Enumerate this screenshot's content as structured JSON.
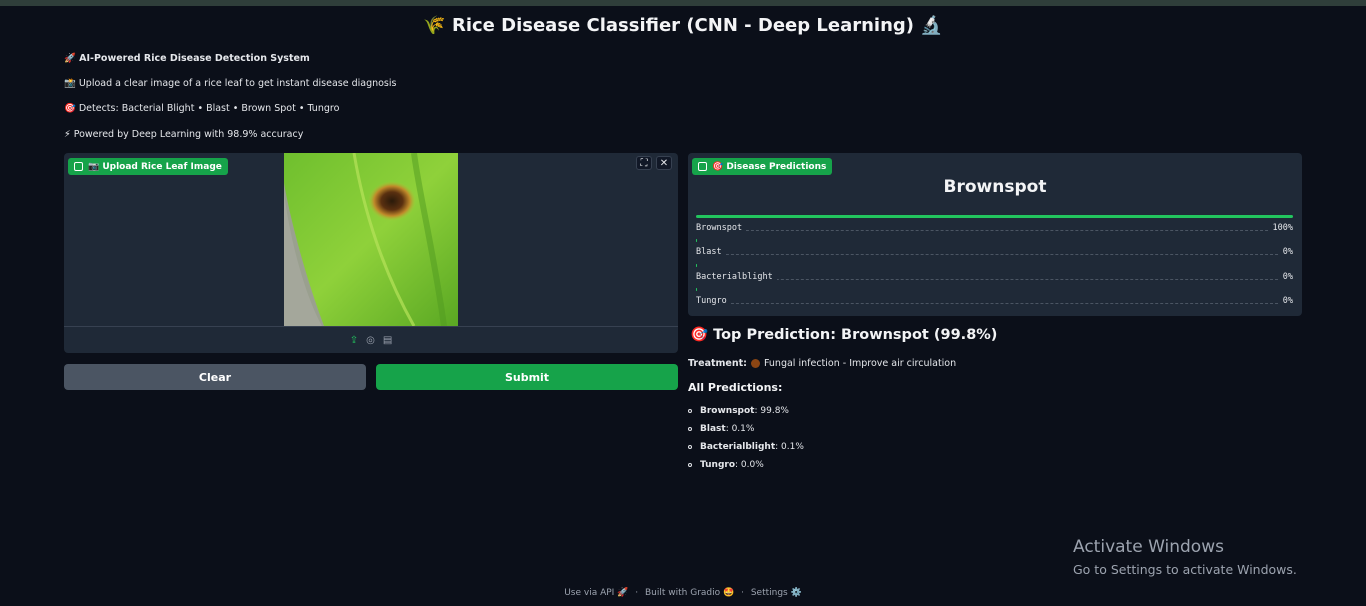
{
  "header": {
    "title": "🌾 Rice Disease Classifier (CNN - Deep Learning) 🔬"
  },
  "intro": {
    "line1": "🚀 AI-Powered Rice Disease Detection System",
    "line2": "📸 Upload a clear image of a rice leaf to get instant disease diagnosis",
    "line3": "🎯 Detects: Bacterial Blight • Blast • Brown Spot • Tungro",
    "line4": "⚡ Powered by Deep Learning with 98.9% accuracy"
  },
  "upload": {
    "label": "📷 Upload Rice Leaf Image",
    "fullscreen_icon": "fullscreen-icon",
    "close_icon": "close-icon",
    "footer_icons": [
      "upload-icon",
      "webcam-icon",
      "clipboard-icon"
    ]
  },
  "buttons": {
    "clear": "Clear",
    "submit": "Submit"
  },
  "predictions_panel": {
    "label": "🎯 Disease Predictions",
    "top_label": "Brownspot",
    "rows": [
      {
        "name": "Brownspot",
        "pct": "100%",
        "fraction": 1.0
      },
      {
        "name": "Blast",
        "pct": "0%",
        "fraction": 0.0
      },
      {
        "name": "Bacterialblight",
        "pct": "0%",
        "fraction": 0.0
      },
      {
        "name": "Tungro",
        "pct": "0%",
        "fraction": 0.0
      }
    ]
  },
  "result": {
    "top_prediction": "🎯 Top Prediction: Brownspot (99.8%)",
    "treatment_label": "Treatment:",
    "treatment_text": "Fungal infection - Improve air circulation",
    "all_heading": "All Predictions:",
    "all": [
      {
        "name": "Brownspot",
        "value": ": 99.8%"
      },
      {
        "name": "Blast",
        "value": ": 0.1%"
      },
      {
        "name": "Bacterialblight",
        "value": ": 0.1%"
      },
      {
        "name": "Tungro",
        "value": ": 0.0%"
      }
    ]
  },
  "watermark": {
    "title": "Activate Windows",
    "subtitle": "Go to Settings to activate Windows."
  },
  "footer": {
    "api": "Use via API 🚀",
    "sep": "·",
    "built": "Built with Gradio 🤩",
    "settings": "Settings ⚙️"
  },
  "colors": {
    "background": "#0b0f19",
    "panel": "#1f2937",
    "accent": "#16a34a",
    "clear_button": "#4b5563"
  }
}
